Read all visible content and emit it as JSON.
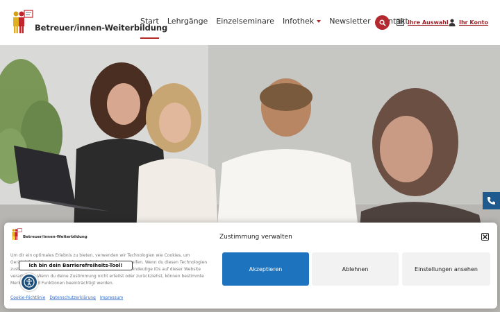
{
  "header": {
    "logo_text": "Betreuer/innen-Weiterbildung",
    "nav": [
      {
        "label": "Start"
      },
      {
        "label": "Lehrgänge"
      },
      {
        "label": "Einzelseminare"
      },
      {
        "label": "Infothek"
      },
      {
        "label": "Newsletter"
      },
      {
        "label": "Kontakt"
      }
    ],
    "icons": {
      "search": "search-icon",
      "selection": "list-icon",
      "account": "user-icon"
    },
    "selection_label": "Ihre Auswahl",
    "account_label": "Ihr Konto",
    "accent_color": "#b3292f"
  },
  "hero": {
    "phone_icon": "phone-icon"
  },
  "consent": {
    "logo_text": "Betreuer/innen-Weiterbildung",
    "title": "Zustimmung verwalten",
    "body": "Um dir ein optimales Erlebnis zu bieten, verwenden wir Technologien wie Cookies, um Geräteinformationen zu speichern und/oder darauf zuzugreifen. Wenn du diesen Technologien zustimmst, können wir Daten wie das Surfverhalten oder eindeutige IDs auf dieser Website verarbeiten. Wenn du deine Zustimmung nicht erteilst oder zurückziehst, können bestimmte Merkmale und Funktionen beeinträchtigt werden.",
    "accept": "Akzeptieren",
    "reject": "Ablehnen",
    "preferences": "Einstellungen ansehen",
    "links": [
      "Cookie-Richtlinie",
      "Datenschutzerklärung",
      "Impressum"
    ],
    "accept_color": "#1e73be"
  },
  "a11y": {
    "tooltip": "Ich bin dein Barrierefreiheits-Tool!",
    "icon": "accessibility-icon"
  }
}
